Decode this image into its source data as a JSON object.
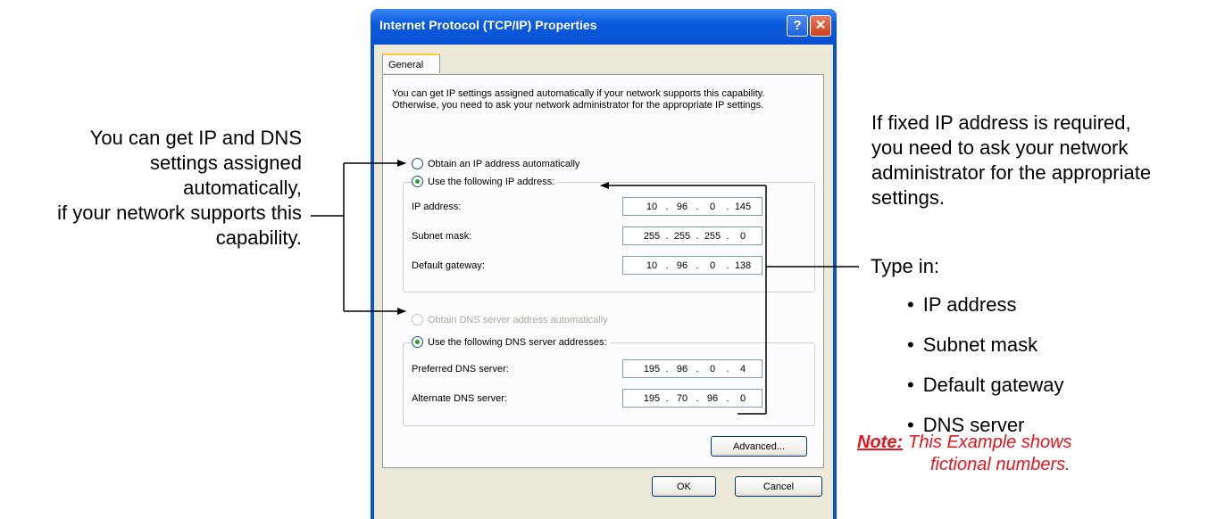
{
  "annotations": {
    "left_lines": [
      "You can get IP and DNS",
      "settings assigned",
      "automatically,",
      "if your network supports this",
      "capability."
    ],
    "right_lines": [
      "If fixed IP address is required,",
      "you need to ask your network",
      "administrator for the appropriate",
      "settings."
    ],
    "type_in": "Type in:",
    "bullets": [
      "IP address",
      "Subnet mask",
      "Default gateway",
      "DNS server"
    ],
    "note_label": "Note:",
    "note_line1": "This Example shows",
    "note_line2": "fictional numbers.",
    "note_color": "#e8141b"
  },
  "dialog": {
    "title": "Internet Protocol (TCP/IP) Properties",
    "help_button": "?",
    "close_button": "✕",
    "tab": "General",
    "intro": "You can get IP settings assigned automatically if your network supports this capability. Otherwise, you need to ask your network administrator for the appropriate IP settings.",
    "radio_auto_ip": "Obtain an IP address automatically",
    "radio_manual_ip": "Use the following IP address:",
    "ip_fields": [
      {
        "label": "IP address:",
        "value": [
          "10",
          "96",
          "0",
          "145"
        ]
      },
      {
        "label": "Subnet mask:",
        "value": [
          "255",
          "255",
          "255",
          "0"
        ]
      },
      {
        "label": "Default gateway:",
        "value": [
          "10",
          "96",
          "0",
          "138"
        ]
      }
    ],
    "radio_auto_dns": "Obtain DNS server address automatically",
    "radio_manual_dns": "Use the following DNS server addresses:",
    "dns_fields": [
      {
        "label": "Preferred DNS server:",
        "value": [
          "195",
          "96",
          "0",
          "4"
        ]
      },
      {
        "label": "Alternate DNS server:",
        "value": [
          "195",
          "70",
          "96",
          "0"
        ]
      }
    ],
    "advanced_button": "Advanced...",
    "ok_button": "OK",
    "cancel_button": "Cancel",
    "title_bar_color": "#0a54d4"
  }
}
